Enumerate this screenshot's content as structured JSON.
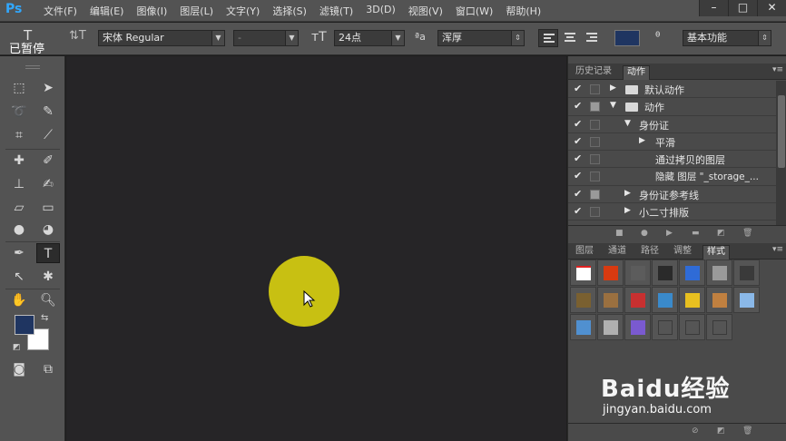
{
  "app": {
    "logo": "Ps"
  },
  "menu": [
    "文件(F)",
    "编辑(E)",
    "图像(I)",
    "图层(L)",
    "文字(Y)",
    "选择(S)",
    "滤镜(T)",
    "3D(D)",
    "视图(V)",
    "窗口(W)",
    "帮助(H)"
  ],
  "window_controls": {
    "minimize": "–",
    "maximize": "□",
    "close": "✕"
  },
  "status_overlay": "已暂停",
  "options": {
    "tool_glyph": "T",
    "font_family": "宋体 Regular",
    "font_style": "-",
    "font_size": "24点",
    "antialias": "浑厚",
    "aa_icon": "ªa",
    "text_color": "#1f3561",
    "workspace": "基本功能"
  },
  "history_panel": {
    "tabs": [
      "历史记录",
      "动作"
    ],
    "active_tab": "动作",
    "actions": [
      {
        "label": "默认动作",
        "type": "set",
        "dialog": false,
        "expanded": false
      },
      {
        "label": "动作",
        "type": "set",
        "dialog": true,
        "expanded": true
      },
      {
        "label": "身份证",
        "type": "action",
        "dialog": false,
        "expanded": true
      },
      {
        "label": "平滑",
        "type": "step",
        "dialog": false,
        "expanded": false
      },
      {
        "label": "通过拷贝的图层",
        "type": "step",
        "dialog": false
      },
      {
        "label": "隐藏 图层 \"_storage_...",
        "type": "step",
        "dialog": false
      },
      {
        "label": "身份证参考线",
        "type": "action",
        "dialog": true,
        "expanded": false
      },
      {
        "label": "小二寸排版",
        "type": "action",
        "dialog": false,
        "expanded": false
      }
    ]
  },
  "layers_panel": {
    "tabs": [
      "图层",
      "通道",
      "路径",
      "调整",
      "样式"
    ],
    "active_tab": "样式",
    "styles": [
      "#ffffff",
      "#d83a10",
      "#5c5c5c",
      "#2a2a2a",
      "#2f6bd6",
      "#9a9a9a",
      "#3a3a3a",
      "#7a6030",
      "#9a7040",
      "#c83030",
      "#3a8acb",
      "#e8c020",
      "#c08040",
      "#8ab8e8",
      "#5090d0",
      "#b0b0b0",
      "#7a5ad0",
      "#555555",
      "#555555",
      "#555555"
    ]
  },
  "watermark": {
    "logo": "Baidu经验",
    "url": "jingyan.baidu.com"
  },
  "colors": {
    "foreground": "#1f3561",
    "background": "#ffffff",
    "highlight": "#c8c012"
  }
}
